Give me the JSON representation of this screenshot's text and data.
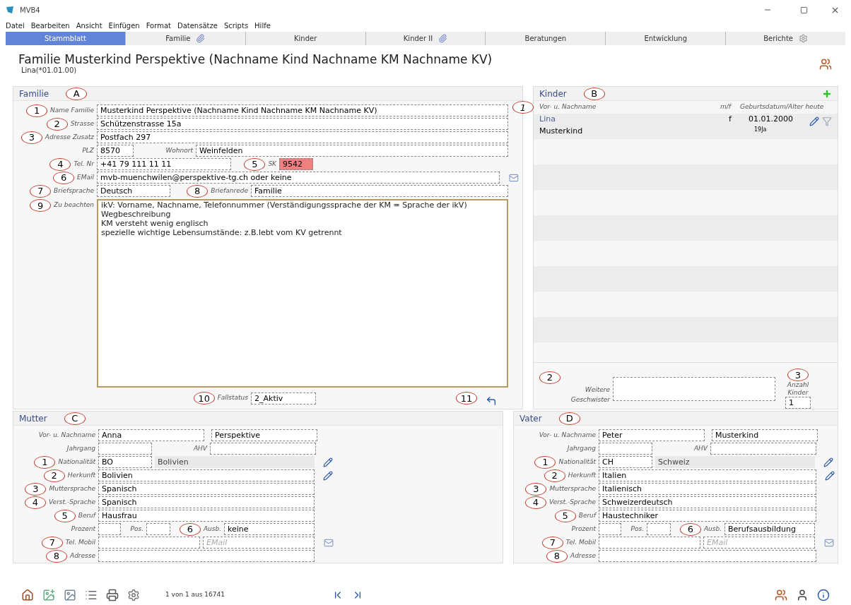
{
  "window": {
    "title": "MVB4"
  },
  "menu": [
    "Datei",
    "Bearbeiten",
    "Ansicht",
    "Einfügen",
    "Format",
    "Datensätze",
    "Scripts",
    "Hilfe"
  ],
  "tabs": [
    {
      "label": "Stammblatt",
      "selected": true,
      "has_attachment": false
    },
    {
      "label": "Familie",
      "selected": false,
      "has_attachment": true
    },
    {
      "label": "Kinder",
      "selected": false,
      "has_attachment": false
    },
    {
      "label": "Kinder II",
      "selected": false,
      "has_attachment": true
    },
    {
      "label": "Beratungen",
      "selected": false,
      "has_attachment": false
    },
    {
      "label": "Entwicklung",
      "selected": false,
      "has_attachment": false
    },
    {
      "label": "Berichte",
      "selected": false,
      "has_attachment": false
    }
  ],
  "header": {
    "title": "Familie Musterkind Perspektive (Nachname Kind Nachname KM Nachname KV)",
    "subtitle": "Lina(*01.01.00)"
  },
  "familie": {
    "title": "Familie",
    "marker": "A",
    "name": {
      "marker": "1",
      "label": "Name Familie",
      "value": "Musterkind Perspektive (Nachname Kind Nachname KM Nachname KV)"
    },
    "strasse": {
      "marker": "2",
      "label": "Strasse",
      "value": "Schützenstrasse 15a"
    },
    "adresse_zusatz": {
      "marker": "3",
      "label": "Adresse Zusatz",
      "value": "Postfach 297"
    },
    "plz": {
      "label": "PLZ",
      "value": "8570"
    },
    "wohnort": {
      "label": "Wohnort",
      "value": "Weinfelden"
    },
    "tel": {
      "marker": "4",
      "label": "Tel. Nr",
      "value": "+41 79 111 11 11"
    },
    "sk": {
      "marker": "5",
      "label": "SK",
      "value": "9542",
      "highlighted": true
    },
    "email": {
      "marker": "6",
      "label": "EMail",
      "value": "mvb-muenchwilen@perspektive-tg.ch oder keine"
    },
    "briefsprache": {
      "marker": "7",
      "label": "Briefsprache",
      "value": "Deutsch"
    },
    "briefanrede": {
      "marker": "8",
      "label": "Briefanrede",
      "value": "Familie"
    },
    "zu_beachten": {
      "marker": "9",
      "label": "Zu beachten",
      "lines": [
        "ikV: Vorname, Nachname, Telefonnummer (Verständigungssprache der KM = Sprache der ikV)",
        "Wegbeschreibung",
        "KM versteht wenig englisch",
        "spezielle wichtige Lebensumstände: z.B.lebt vom KV getrennt"
      ]
    },
    "fallstatus": {
      "marker": "10",
      "label": "Fallstatus",
      "value": "2_Aktiv"
    },
    "back_marker": "11"
  },
  "kinder": {
    "title": "Kinder",
    "marker": "B",
    "column_marker": "1",
    "columns": [
      "Vor- u. Nachname",
      "m/f",
      "Geburtsdatum/Alter heute"
    ],
    "rows": [
      {
        "first_name": "Lina",
        "last_name": "Musterkind",
        "sex": "f",
        "birth": "01.01.2000",
        "age": "19Ja"
      }
    ],
    "geschwister": {
      "marker": "2",
      "label": "Weitere Geschwister"
    },
    "anzahl": {
      "marker": "3",
      "label": "Anzahl Kinder",
      "value": "1"
    }
  },
  "parents": [
    {
      "title": "Mutter",
      "marker": "C",
      "name": {
        "label": "Vor- u. Nachname",
        "first": "Anna",
        "last": "Perspektive"
      },
      "jahrgang": {
        "label": "Jahrgang"
      },
      "ahv": {
        "label": "AHV"
      },
      "nationalitaet": {
        "marker": "1",
        "label": "Nationalität",
        "code": "BO",
        "name": "Bolivien"
      },
      "herkunft": {
        "marker": "2",
        "label": "Herkunft",
        "value": "Bolivien"
      },
      "muttersprache": {
        "marker": "3",
        "label": "Muttersprache",
        "value": "Spanisch"
      },
      "verst_sprache": {
        "marker": "4",
        "label": "Verst.-Sprache",
        "value": "Spanisch"
      },
      "beruf": {
        "marker": "5",
        "label": "Beruf",
        "value": "Hausfrau"
      },
      "prozent": {
        "label": "Prozent"
      },
      "pos": {
        "label": "Pos."
      },
      "ausbildung": {
        "marker": "6",
        "label": "Ausb.",
        "value": "keine"
      },
      "tel_mobil": {
        "marker": "7",
        "label": "Tel. Mobil"
      },
      "email": {
        "placeholder": "EMail"
      },
      "adresse": {
        "marker": "8",
        "label": "Adresse"
      }
    },
    {
      "title": "Vater",
      "marker": "D",
      "name": {
        "label": "Vor- u. Nachname",
        "first": "Peter",
        "last": "Musterkind"
      },
      "jahrgang": {
        "label": "Jahrgang"
      },
      "ahv": {
        "label": "AHV"
      },
      "nationalitaet": {
        "marker": "1",
        "label": "Nationalität",
        "code": "CH",
        "name": "Schweiz"
      },
      "herkunft": {
        "marker": "2",
        "label": "Herkunft",
        "value": "Italien"
      },
      "muttersprache": {
        "marker": "3",
        "label": "Muttersprache",
        "value": "Italienisch"
      },
      "verst_sprache": {
        "marker": "4",
        "label": "Verst.-Sprache",
        "value": "Schweizerdeutsch"
      },
      "beruf": {
        "marker": "5",
        "label": "Beruf",
        "value": "Haustechniker"
      },
      "prozent": {
        "label": "Prozent"
      },
      "pos": {
        "label": "Pos."
      },
      "ausbildung": {
        "marker": "6",
        "label": "Ausb.",
        "value": "Berufsausbildung"
      },
      "tel_mobil": {
        "marker": "7",
        "label": "Tel. Mobil"
      },
      "email": {
        "placeholder": "EMail"
      },
      "adresse": {
        "marker": "8",
        "label": "Adresse"
      }
    }
  ],
  "status": {
    "record_count": "1 von 1 aus 16741"
  }
}
